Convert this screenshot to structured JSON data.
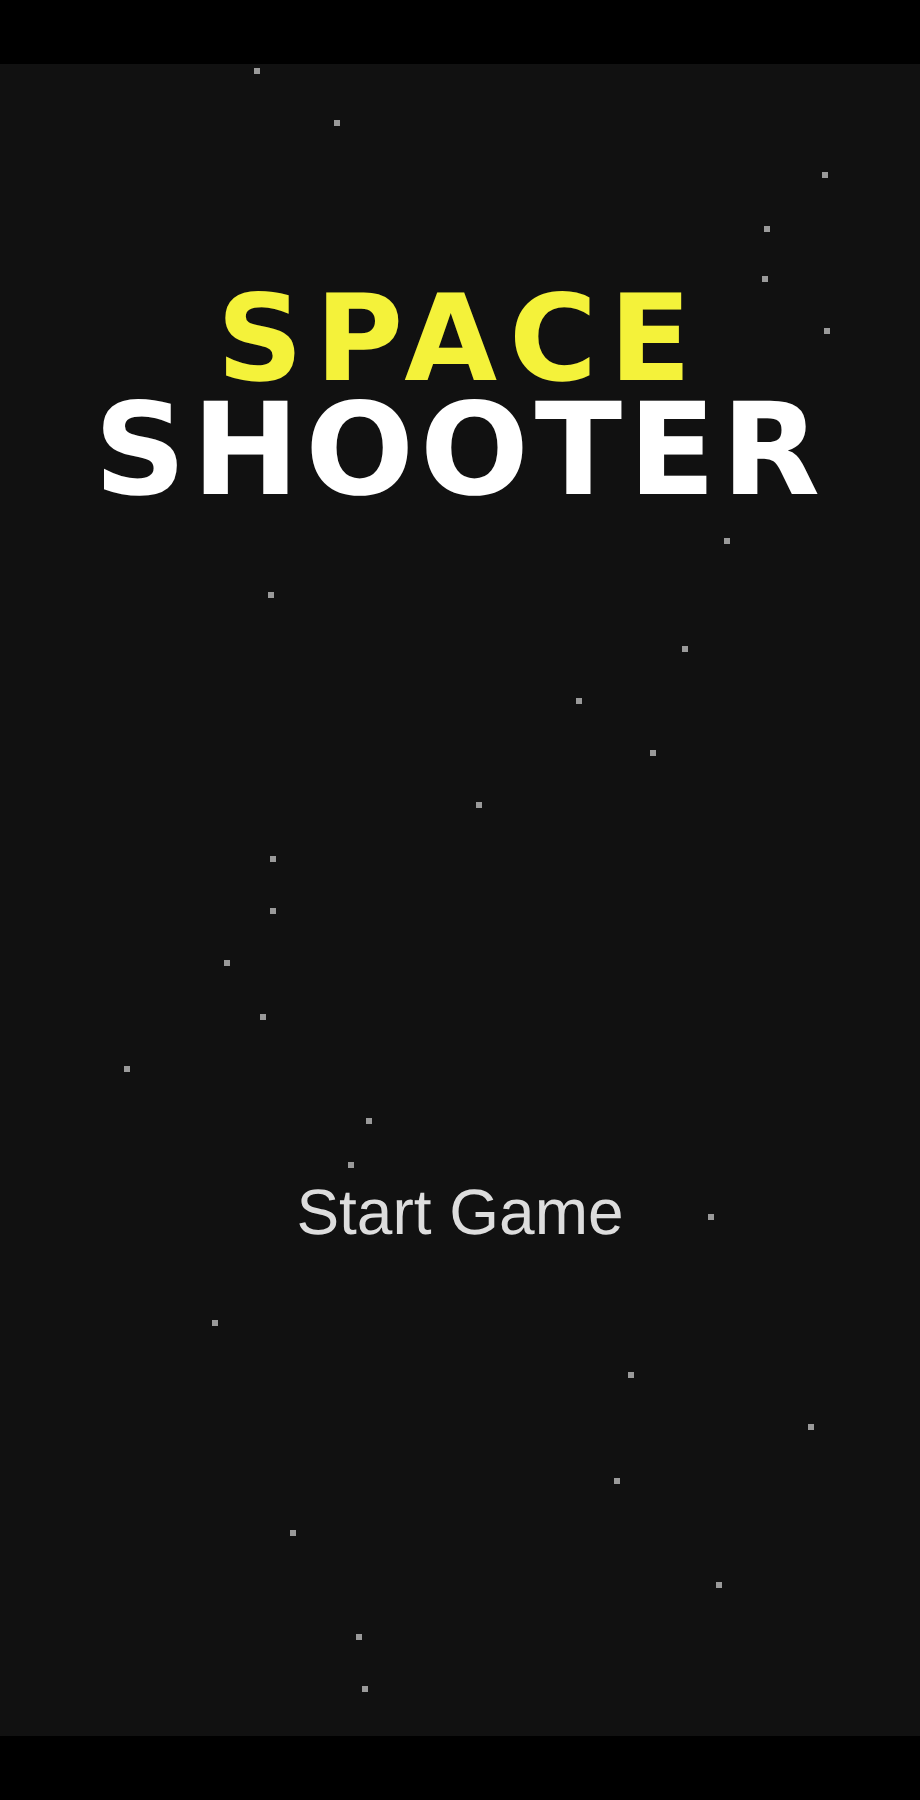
{
  "title": {
    "line_1": "SPACE",
    "line_2": "SHOOTER"
  },
  "menu": [
    {
      "label": "Start Game"
    }
  ]
}
